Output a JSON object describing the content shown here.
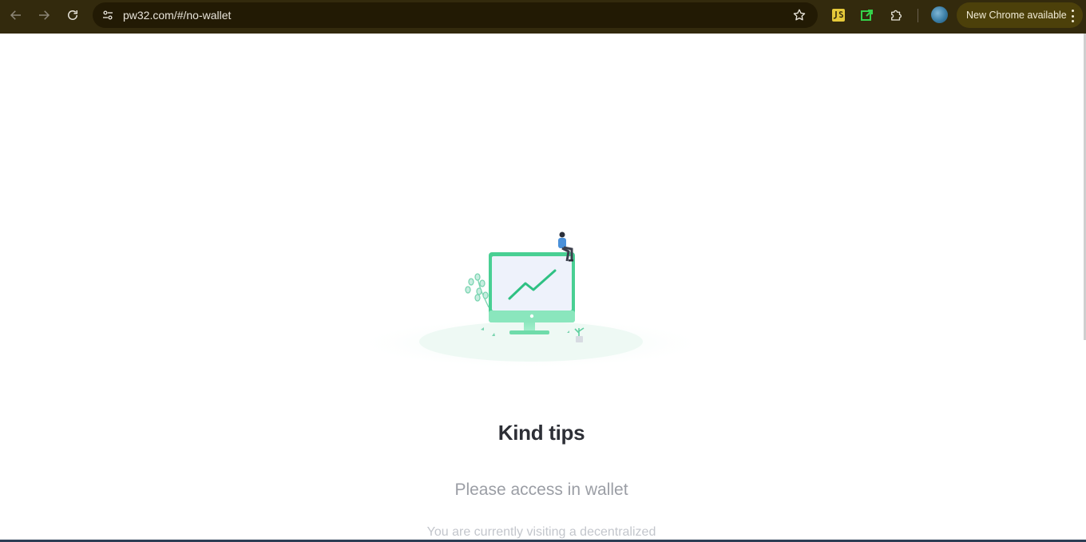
{
  "browser": {
    "url": "pw32.com/#/no-wallet",
    "update_label": "New Chrome available",
    "colors": {
      "toolbar": "#332a0d",
      "omnibox": "#221a04",
      "update_chip": "#4c400a"
    }
  },
  "page": {
    "title": "Kind tips",
    "subtitle": "Please access in wallet",
    "description": "You are currently visiting a decentralized",
    "colors": {
      "accent": "#3ccf91",
      "title": "#2d2f36",
      "subtitle": "#9b9ea5"
    }
  },
  "icons": {
    "back": "arrow-left-icon",
    "forward": "arrow-right-icon",
    "reload": "reload-icon",
    "site_info": "tune-icon",
    "bookmark": "star-icon",
    "extensions": [
      "js-extension-icon",
      "green-extension-icon",
      "puzzle-icon"
    ],
    "profile": "avatar",
    "menu": "three-dots-icon"
  }
}
